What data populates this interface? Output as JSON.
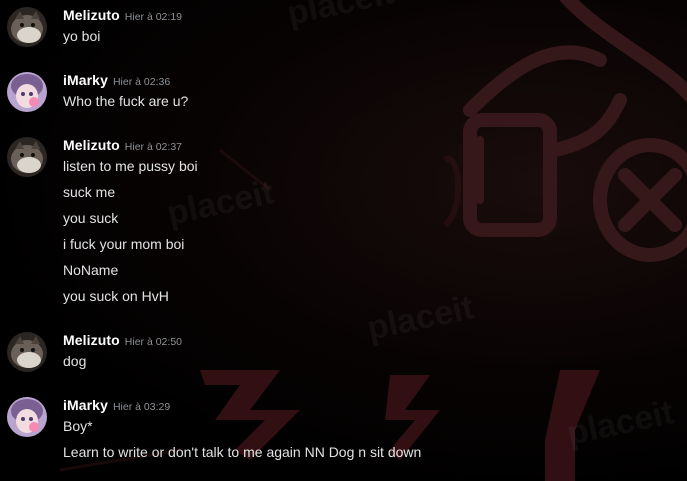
{
  "watermark": "placeit",
  "groups": [
    {
      "username": "Melizuto",
      "timestamp": "Hier à 02:19",
      "avatar": "cat-avatar",
      "lines": [
        "yo boi"
      ]
    },
    {
      "username": "iMarky",
      "timestamp": "Hier à 02:36",
      "avatar": "anime-girl-avatar",
      "lines": [
        "Who the fuck are u?"
      ]
    },
    {
      "username": "Melizuto",
      "timestamp": "Hier à 02:37",
      "avatar": "cat-avatar",
      "lines": [
        "listen to me pussy boi",
        "suck me",
        "you suck",
        "i fuck your mom boi",
        "NoName",
        "you suck on HvH"
      ]
    },
    {
      "username": "Melizuto",
      "timestamp": "Hier à 02:50",
      "avatar": "cat-avatar",
      "lines": [
        "dog"
      ]
    },
    {
      "username": "iMarky",
      "timestamp": "Hier à 03:29",
      "avatar": "anime-girl-avatar",
      "lines": [
        "Boy*",
        "Learn to write or don't talk to me again NN Dog n sit down"
      ]
    }
  ]
}
